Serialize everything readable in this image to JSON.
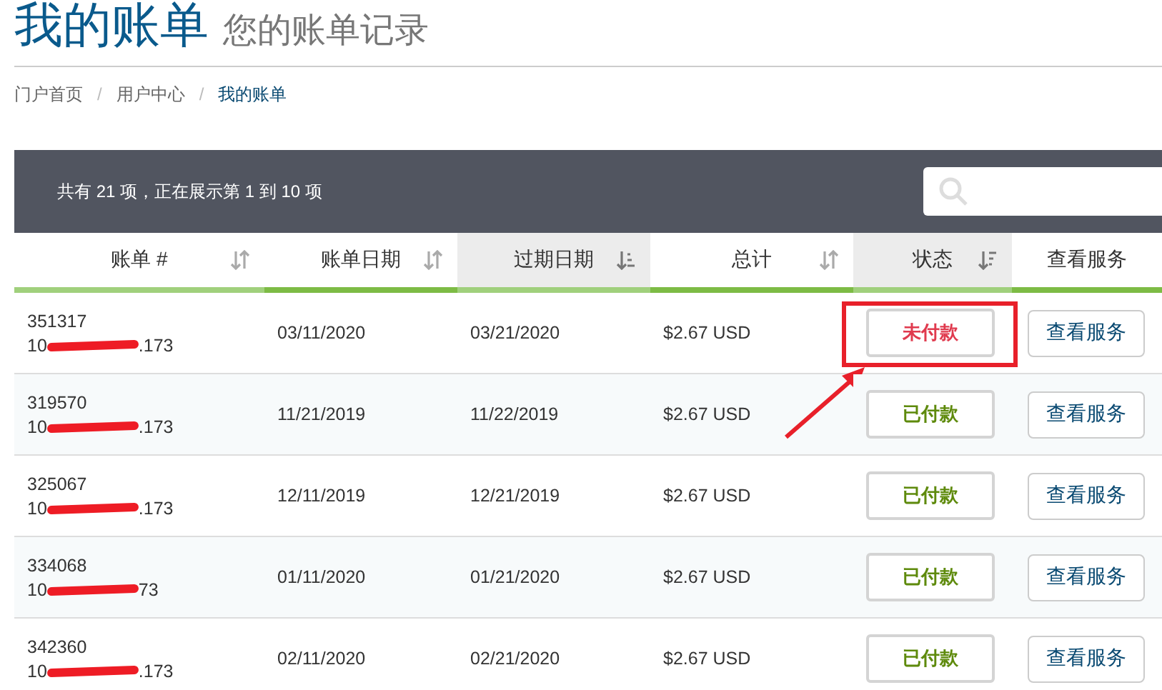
{
  "page": {
    "title": "我的账单",
    "subtitle": "您的账单记录"
  },
  "breadcrumb": [
    {
      "label": "门户首页",
      "current": false
    },
    {
      "label": "用户中心",
      "current": false
    },
    {
      "label": "我的账单",
      "current": true
    }
  ],
  "breadcrumb_separator": "/",
  "table_info": "共有 21 项，正在展示第 1 到 10 项",
  "columns": [
    {
      "label": "账单 #",
      "kind": "none",
      "sorted": false
    },
    {
      "label": "账单日期",
      "kind": "none",
      "sorted": false
    },
    {
      "label": "过期日期",
      "kind": "asc",
      "sorted": true
    },
    {
      "label": "总计",
      "kind": "none",
      "sorted": false
    },
    {
      "label": "状态",
      "kind": "desc",
      "sorted": true
    },
    {
      "label": "查看服务"
    }
  ],
  "rows": [
    {
      "id": "351317",
      "ip_start": "10",
      "ip_end": ".173",
      "date": "03/11/2020",
      "due": "03/21/2020",
      "total": "$2.67 USD",
      "status": "未付款",
      "kind": "unpaid",
      "highlighted": true,
      "action": "查看服务"
    },
    {
      "id": "319570",
      "ip_start": "10",
      "ip_end": ".173",
      "date": "11/21/2019",
      "due": "11/22/2019",
      "total": "$2.67 USD",
      "status": "已付款",
      "kind": "paid",
      "highlighted": false,
      "action": "查看服务"
    },
    {
      "id": "325067",
      "ip_start": "10",
      "ip_end": ".173",
      "date": "12/11/2019",
      "due": "12/21/2019",
      "total": "$2.67 USD",
      "status": "已付款",
      "kind": "paid",
      "highlighted": false,
      "action": "查看服务"
    },
    {
      "id": "334068",
      "ip_start": "10",
      "ip_end": "73",
      "date": "01/11/2020",
      "due": "01/21/2020",
      "total": "$2.67 USD",
      "status": "已付款",
      "kind": "paid",
      "highlighted": false,
      "action": "查看服务"
    },
    {
      "id": "342360",
      "ip_start": "10",
      "ip_end": ".173",
      "date": "02/11/2020",
      "due": "02/21/2020",
      "total": "$2.67 USD",
      "status": "已付款",
      "kind": "paid",
      "highlighted": false,
      "action": "查看服务"
    }
  ]
}
